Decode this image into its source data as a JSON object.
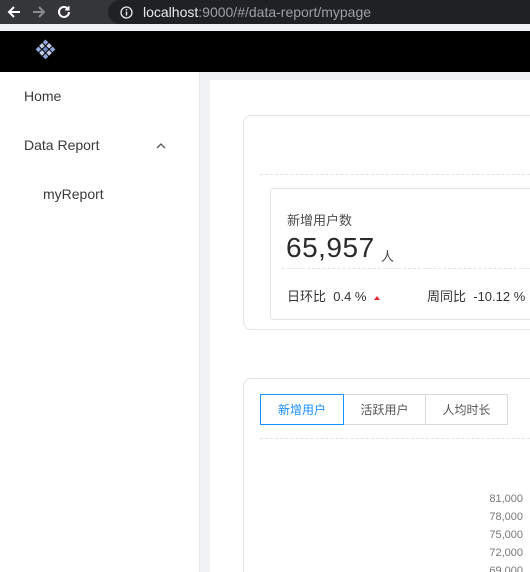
{
  "browser": {
    "url_host": "localhost",
    "url_rest": ":9000/#/data-report/mypage"
  },
  "sidebar": {
    "items": [
      {
        "label": "Home"
      },
      {
        "label": "Data Report"
      }
    ],
    "subitems": [
      {
        "label": "myReport"
      }
    ]
  },
  "stat_card": {
    "label": "新增用户数",
    "value": "65,957",
    "unit": "人",
    "day_compare_label": "日环比",
    "day_compare_value": "0.4 %",
    "week_compare_label": "周同比",
    "week_compare_value": "-10.12 %"
  },
  "tabs": [
    {
      "label": "新增用户",
      "active": true
    },
    {
      "label": "活跃用户",
      "active": false
    },
    {
      "label": "人均时长",
      "active": false
    }
  ],
  "chart_data": {
    "type": "line",
    "y_tick_labels": [
      "81,000",
      "78,000",
      "75,000",
      "72,000",
      "69,000"
    ],
    "y_ticks": [
      81000,
      78000,
      75000,
      72000,
      69000
    ]
  }
}
